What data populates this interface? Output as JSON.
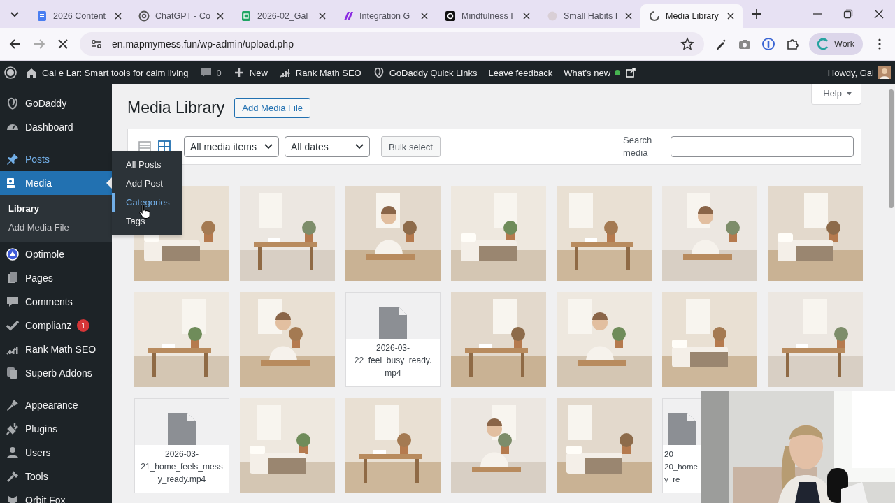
{
  "browser": {
    "tabs": [
      {
        "title": "2026 Content",
        "selected": false,
        "loading": false
      },
      {
        "title": "ChatGPT - Co",
        "selected": false,
        "loading": false
      },
      {
        "title": "2026-02_Gal",
        "selected": false,
        "loading": false
      },
      {
        "title": "Integration G",
        "selected": false,
        "loading": false
      },
      {
        "title": "Mindfulness I",
        "selected": false,
        "loading": false
      },
      {
        "title": "Small Habits I",
        "selected": false,
        "loading": false
      },
      {
        "title": "Media Library",
        "selected": true,
        "loading": true
      }
    ],
    "address": "en.mapmymess.fun/wp-admin/upload.php",
    "profile": "Work"
  },
  "admin_bar": {
    "site": "Gal e Lar: Smart tools for calm living",
    "comments": "0",
    "new": "New",
    "items": [
      "Rank Math SEO",
      "GoDaddy Quick Links",
      "Leave feedback",
      "What's new"
    ],
    "howdy": "Howdy, Gal"
  },
  "sidebar": {
    "groups": [
      [
        {
          "label": "GoDaddy",
          "selected": false,
          "highlighted": false
        },
        {
          "label": "Dashboard",
          "selected": false,
          "highlighted": false
        }
      ],
      [
        {
          "label": "Posts",
          "selected": false,
          "highlighted": true
        },
        {
          "label": "Media",
          "selected": true,
          "highlighted": false,
          "children": [
            {
              "label": "Library",
              "selected": true
            },
            {
              "label": "Add Media File",
              "selected": false
            }
          ]
        },
        {
          "label": "Optimole",
          "selected": false,
          "highlighted": false
        },
        {
          "label": "Pages",
          "selected": false,
          "highlighted": false
        },
        {
          "label": "Comments",
          "selected": false,
          "highlighted": false
        },
        {
          "label": "Complianz",
          "selected": false,
          "highlighted": false,
          "badge": "1"
        },
        {
          "label": "Rank Math SEO",
          "selected": false,
          "highlighted": false
        },
        {
          "label": "Superb Addons",
          "selected": false,
          "highlighted": false
        }
      ],
      [
        {
          "label": "Appearance",
          "selected": false,
          "highlighted": false
        },
        {
          "label": "Plugins",
          "selected": false,
          "highlighted": false
        },
        {
          "label": "Users",
          "selected": false,
          "highlighted": false
        },
        {
          "label": "Tools",
          "selected": false,
          "highlighted": false
        },
        {
          "label": "Orbit Fox",
          "selected": false,
          "highlighted": false
        }
      ]
    ]
  },
  "flyout": {
    "items": [
      {
        "label": "All Posts",
        "selected": false
      },
      {
        "label": "Add Post",
        "selected": false
      },
      {
        "label": "Categories",
        "selected": true
      },
      {
        "label": "Tags",
        "selected": false
      }
    ]
  },
  "content": {
    "title": "Media Library",
    "add_button": "Add Media File",
    "help": "Help",
    "view_modes": [
      {
        "kind": "list",
        "selected": false
      },
      {
        "kind": "grid",
        "selected": true
      }
    ],
    "filters": [
      {
        "value": "All media items"
      },
      {
        "value": "All dates"
      }
    ],
    "bulk_button": "Bulk select",
    "search": {
      "label": "Search media"
    },
    "items": [
      {
        "kind": "picture"
      },
      {
        "kind": "picture"
      },
      {
        "kind": "picture"
      },
      {
        "kind": "picture"
      },
      {
        "kind": "picture"
      },
      {
        "kind": "picture"
      },
      {
        "kind": "picture"
      },
      {
        "kind": "picture"
      },
      {
        "kind": "picture"
      },
      {
        "kind": "file",
        "lines": [
          "2026-03-",
          "22_feel_busy_ready.",
          "mp4"
        ],
        "clipped": false
      },
      {
        "kind": "picture"
      },
      {
        "kind": "picture"
      },
      {
        "kind": "picture"
      },
      {
        "kind": "picture"
      },
      {
        "kind": "file",
        "lines": [
          "2026-03-",
          "21_home_feels_mess",
          "y_ready.mp4"
        ],
        "clipped": false
      },
      {
        "kind": "picture"
      },
      {
        "kind": "picture"
      },
      {
        "kind": "picture"
      },
      {
        "kind": "picture"
      },
      {
        "kind": "file",
        "lines": [
          "20",
          "20_home",
          "y_re"
        ],
        "clipped": true
      }
    ]
  },
  "webcam": {
    "kind": "picture"
  }
}
